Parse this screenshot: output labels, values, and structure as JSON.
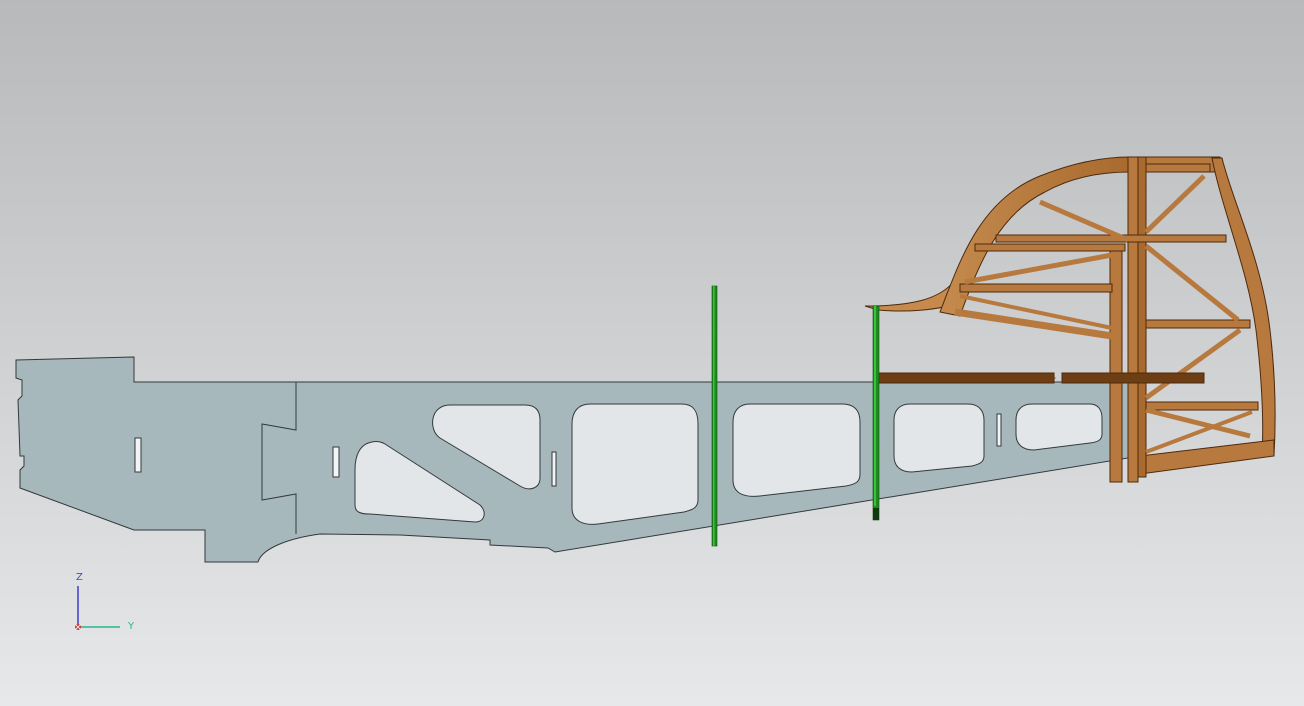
{
  "viewport": {
    "background_top": "#b8b9bb",
    "background_bottom": "#e6e8ea"
  },
  "model": {
    "fuselage_side_color": "#a7b8bd",
    "fuselage_outline_color": "#33393b",
    "wood_color": "#b7793d",
    "wood_dark_color": "#6d3d14",
    "wood_outline_color": "#4e2a0c",
    "rod_color": "#1f8a1f",
    "rod_light_color": "#39c339"
  },
  "triad": {
    "z_label": "Z",
    "y_label": "Y",
    "z_color": "#4a48c8",
    "y_color": "#26b88a",
    "x_color": "#d23a3a"
  }
}
